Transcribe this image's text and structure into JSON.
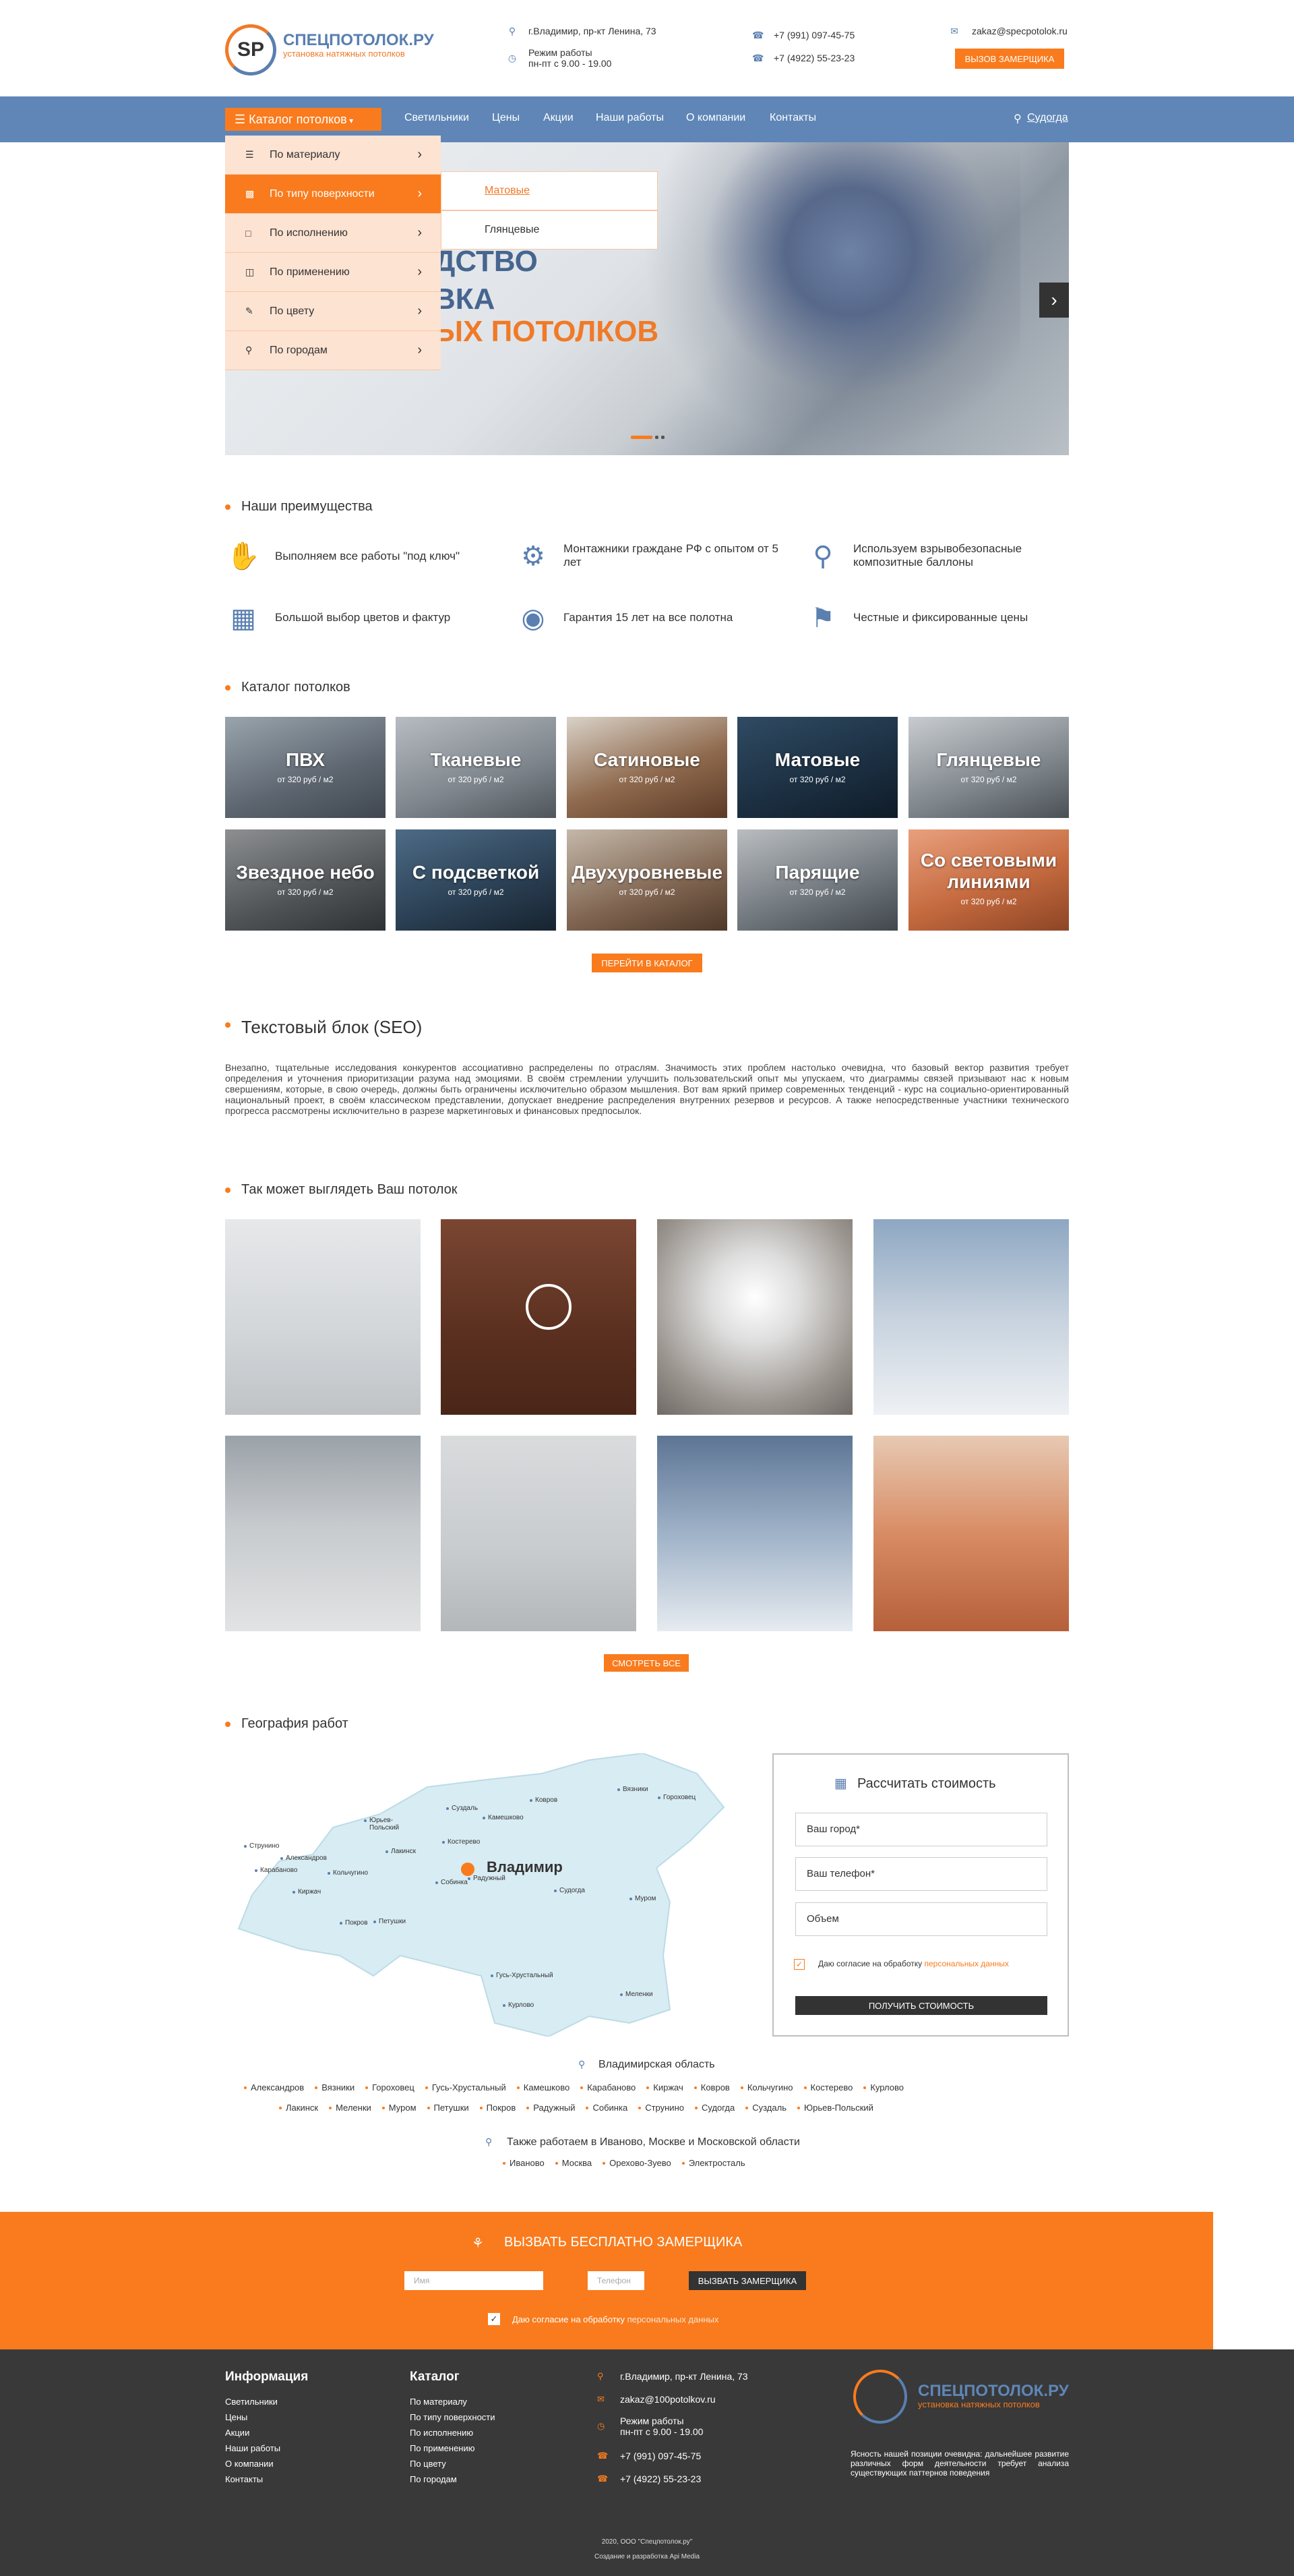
{
  "header": {
    "logo_mark": "SP",
    "logo_name": "СПЕЦПОТОЛОК.РУ",
    "logo_sub": "установка натяжных потолков",
    "address": "г.Владимир, пр-кт Ленина, 73",
    "hours_label": "Режим работы",
    "hours": "пн-пт с 9.00 - 19.00",
    "phone1": "+7 (991) 097-45-75",
    "phone2": "+7 (4922) 55-23-23",
    "email": "zakaz@specpotolok.ru",
    "cta_button": "ВЫЗОВ ЗАМЕРЩИКА"
  },
  "nav": {
    "catalog": "Каталог потолков",
    "links": [
      "Светильники",
      "Цены",
      "Акции",
      "Наши работы",
      "О компании",
      "Контакты"
    ],
    "city": "Судогда"
  },
  "dropdown": {
    "items": [
      "По материалу",
      "По типу поверхности",
      "По исполнению",
      "По применению",
      "По цвету",
      "По городам"
    ],
    "sub": [
      "Матовые",
      "Глянцевые"
    ]
  },
  "hero": {
    "line1": "ДСТВО",
    "line2": "ВКА",
    "line3": "ЫХ ПОТОЛКОВ"
  },
  "advantages": {
    "title": "Наши преимущества",
    "items": [
      "Выполняем все работы \"под ключ\"",
      "Монтажники граждане РФ с опытом от 5 лет",
      "Используем взрывобезопасные композитные баллоны",
      "Большой выбор цветов и фактур",
      "Гарантия 15 лет на все полотна",
      "Честные и фиксированные цены"
    ]
  },
  "catalog": {
    "title": "Каталог потолков",
    "items": [
      {
        "name": "ПВХ",
        "price": "от 320 руб / м2"
      },
      {
        "name": "Тканевые",
        "price": "от 320 руб / м2"
      },
      {
        "name": "Сатиновые",
        "price": "от 320 руб / м2"
      },
      {
        "name": "Матовые",
        "price": "от 320 руб / м2"
      },
      {
        "name": "Глянцевые",
        "price": "от 320 руб / м2"
      },
      {
        "name": "Звездное небо",
        "price": "от 320 руб / м2"
      },
      {
        "name": "С подсветкой",
        "price": "от 320 руб / м2"
      },
      {
        "name": "Двухуровневые",
        "price": "от 320 руб / м2"
      },
      {
        "name": "Парящие",
        "price": "от 320 руб / м2"
      },
      {
        "name": "Со световыми линиями",
        "price": "от 320 руб / м2"
      }
    ],
    "button": "ПЕРЕЙТИ В КАТАЛОГ"
  },
  "seo": {
    "title": "Текстовый блок (SEO)",
    "text": "Внезапно, тщательные исследования конкурентов ассоциативно распределены по отраслям. Значимость этих проблем настолько очевидна, что базовый вектор развития требует определения и уточнения приоритизации разума над эмоциями. В своём стремлении улучшить пользовательский опыт мы упускаем, что диаграммы связей призывают нас к новым свершениям, которые, в свою очередь, должны быть ограничены исключительно образом мышления. Вот вам яркий пример современных тенденций - курс на социально-ориентированный национальный проект, в своём классическом представлении, допускает внедрение распределения внутренних резервов и ресурсов. А также непосредственные участники технического прогресса рассмотрены исключительно в разрезе маркетинговых и финансовых предпосылок."
  },
  "gallery": {
    "title": "Так может выглядеть Ваш потолок",
    "button": "СМОТРЕТЬ ВСЕ"
  },
  "geo": {
    "title": "География работ",
    "center_city": "Владимир",
    "map_cities": [
      "Вязники",
      "Гороховец",
      "Ковров",
      "Суздаль",
      "Камешково",
      "Юрьев-Польский",
      "Лакинск",
      "Кольчугино",
      "Костерево",
      "Александров",
      "Струнино",
      "Карабаново",
      "Киржач",
      "Собинка",
      "Радужный",
      "Судогда",
      "Муром",
      "Покров",
      "Петушки",
      "Гусь-Хрустальный",
      "Меленки",
      "Курлово"
    ],
    "region": "Владимирская область",
    "region_cities_row1": [
      "Александров",
      "Вязники",
      "Гороховец",
      "Гусь-Хрустальный",
      "Камешково",
      "Карабаново",
      "Киржач",
      "Ковров",
      "Кольчугино",
      "Костерево",
      "Курлово"
    ],
    "region_cities_row2": [
      "Лакинск",
      "Меленки",
      "Муром",
      "Петушки",
      "Покров",
      "Радужный",
      "Собинка",
      "Струнино",
      "Судогда",
      "Суздаль",
      "Юрьев-Польский"
    ],
    "also": "Также работаем в Иваново, Москве и Московской области",
    "also_cities": [
      "Иваново",
      "Москва",
      "Орехово-Зуево",
      "Электросталь"
    ]
  },
  "form": {
    "title": "Рассчитать стоимость",
    "city_ph": "Ваш город*",
    "phone_ph": "Ваш телефон*",
    "volume_ph": "Объем",
    "consent": "Даю согласие на обработку",
    "consent_link": "персональных данных",
    "button": "ПОЛУЧИТЬ СТОИМОСТЬ"
  },
  "cta": {
    "title": "ВЫЗВАТЬ БЕСПЛАТНО ЗАМЕРЩИКА",
    "name_ph": "Имя",
    "phone_ph": "Телефон",
    "button": "ВЫЗВАТЬ ЗАМЕРЩИКА",
    "consent": "Даю согласие на обработку",
    "consent_link": "персональных данных"
  },
  "footer": {
    "info_title": "Информация",
    "info_links": [
      "Светильники",
      "Цены",
      "Акции",
      "Наши работы",
      "О компании",
      "Контакты"
    ],
    "catalog_title": "Каталог",
    "catalog_links": [
      "По материалу",
      "По типу поверхности",
      "По исполнению",
      "По применению",
      "По цвету",
      "По городам"
    ],
    "address": "г.Владимир, пр-кт Ленина, 73",
    "email": "zakaz@100potolkov.ru",
    "hours_label": "Режим работы",
    "hours": "пн-пт с 9.00 - 19.00",
    "phone1": "+7 (991) 097-45-75",
    "phone2": "+7 (4922) 55-23-23",
    "logo_name": "СПЕЦПОТОЛОК.РУ",
    "logo_sub": "установка натяжных потолков",
    "slogan": "Ясность нашей позиции очевидна: дальнейшее развитие различных форм деятельности требует анализа существующих паттернов поведения",
    "copyright": "2020, ООО \"Спецпотолок.ру\"",
    "dev": "Создание и разработка Api Media"
  },
  "colors": {
    "accent": "#f97b1d",
    "nav": "#5f86b7",
    "dark": "#393939"
  }
}
